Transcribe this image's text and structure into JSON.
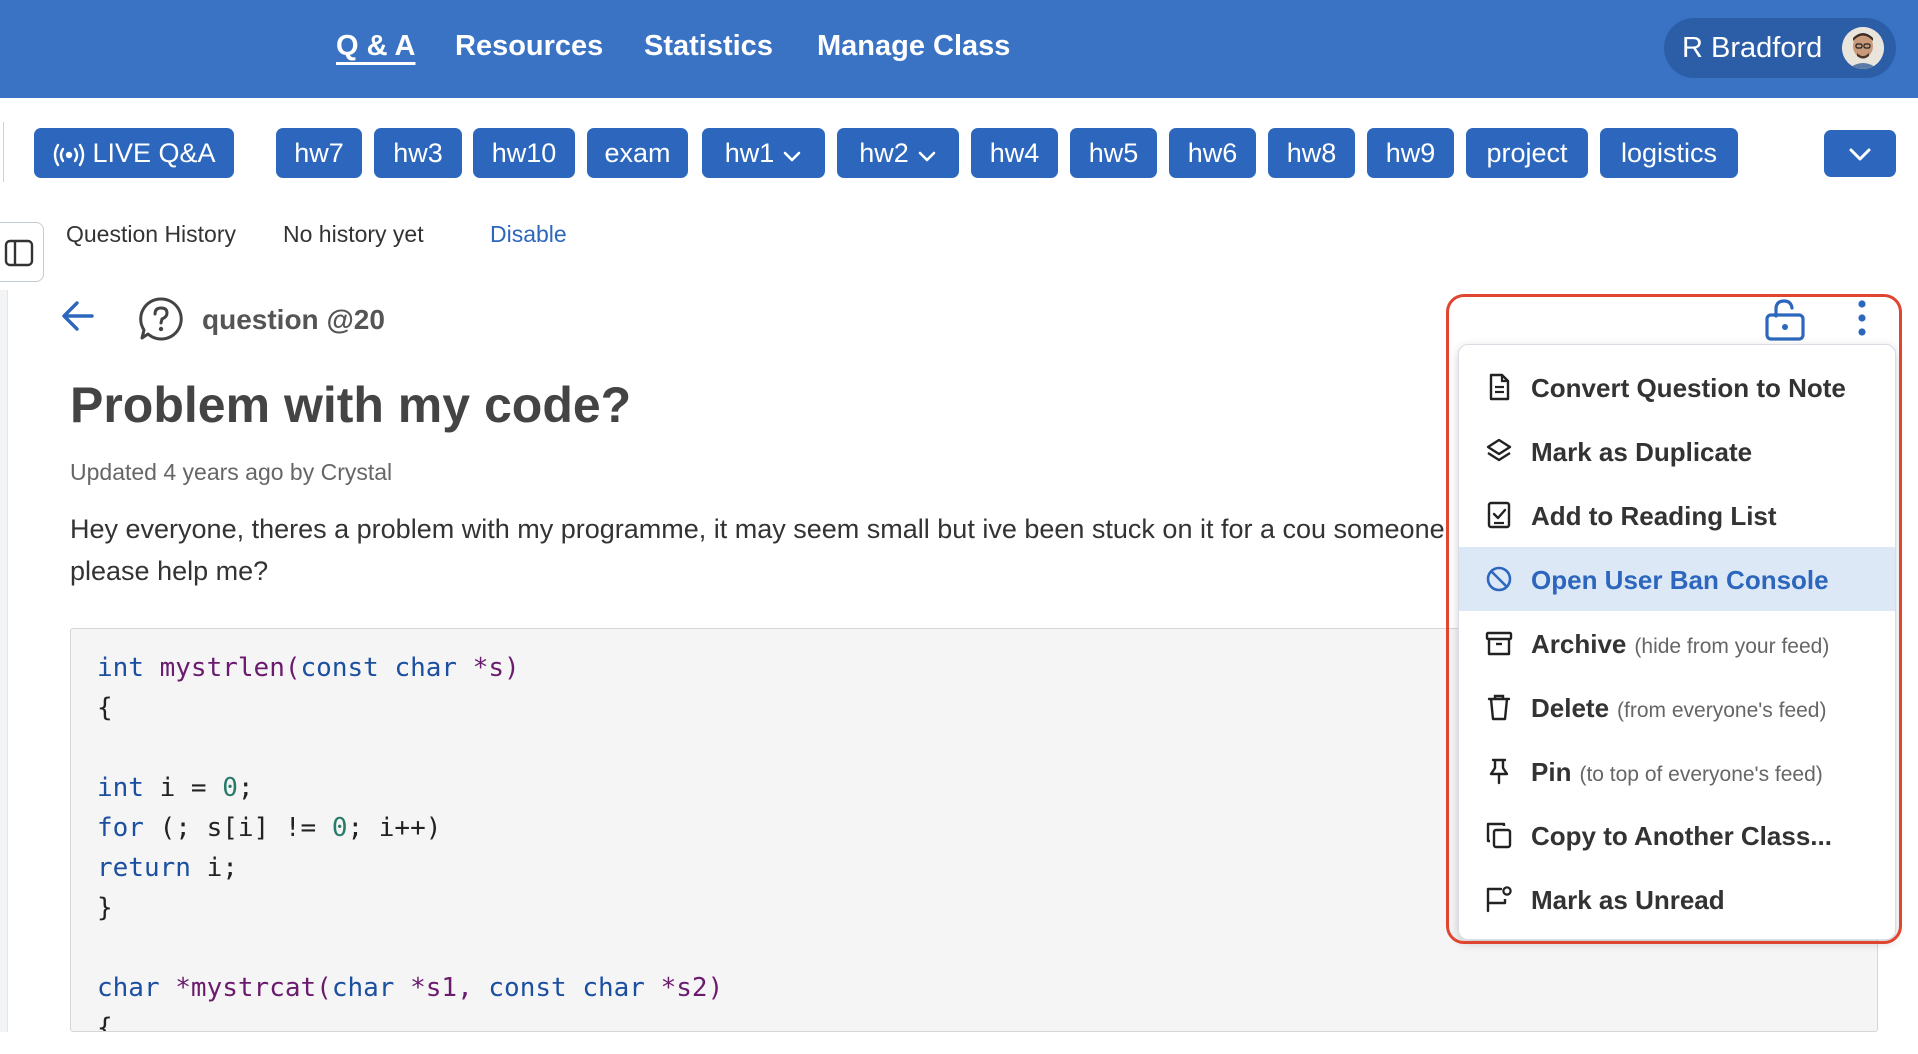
{
  "nav": {
    "links": [
      "Q & A",
      "Resources",
      "Statistics",
      "Manage Class"
    ],
    "user_name": "R Bradford"
  },
  "folders": {
    "live_label": "LIVE Q&A",
    "chips": [
      "hw7",
      "hw3",
      "hw10",
      "exam",
      "hw1",
      "hw2",
      "hw4",
      "hw5",
      "hw6",
      "hw8",
      "hw9",
      "project",
      "logistics"
    ]
  },
  "history": {
    "label": "Question History",
    "status": "No history yet",
    "disable_label": "Disable"
  },
  "post": {
    "type_label": "question @20",
    "title": "Problem with my code?",
    "meta": "Updated 4 years ago by Crystal",
    "body": "Hey everyone, theres a problem with my programme, it may seem small but ive been stuck on it for a cou someone please help me?",
    "code_lines": [
      "int mystrlen(const char *s)",
      "{",
      "",
      "int i = 0;",
      "for (; s[i] != 0; i++)",
      "return i;",
      "}",
      "",
      "char *mystrcat(char *s1, const char *s2)",
      "{"
    ]
  },
  "menu": {
    "items": [
      {
        "label": "Convert Question to Note",
        "sub": "",
        "icon": "document-icon"
      },
      {
        "label": "Mark as Duplicate",
        "sub": "",
        "icon": "layers-icon"
      },
      {
        "label": "Add to Reading List",
        "sub": "",
        "icon": "checklist-icon"
      },
      {
        "label": "Open User Ban Console",
        "sub": "",
        "icon": "ban-icon"
      },
      {
        "label": "Archive",
        "sub": "(hide from your feed)",
        "icon": "archive-icon"
      },
      {
        "label": "Delete",
        "sub": "(from everyone's feed)",
        "icon": "trash-icon"
      },
      {
        "label": "Pin",
        "sub": "(to top of everyone's feed)",
        "icon": "pin-icon"
      },
      {
        "label": "Copy to Another Class...",
        "sub": "",
        "icon": "copy-icon"
      },
      {
        "label": "Mark as Unread",
        "sub": "",
        "icon": "unread-flag-icon"
      }
    ]
  },
  "colors": {
    "brand_blue": "#3a72c4",
    "chip_blue": "#2d67bd",
    "highlight_outline": "#e0452f",
    "menu_hover": "#dde8f6"
  }
}
